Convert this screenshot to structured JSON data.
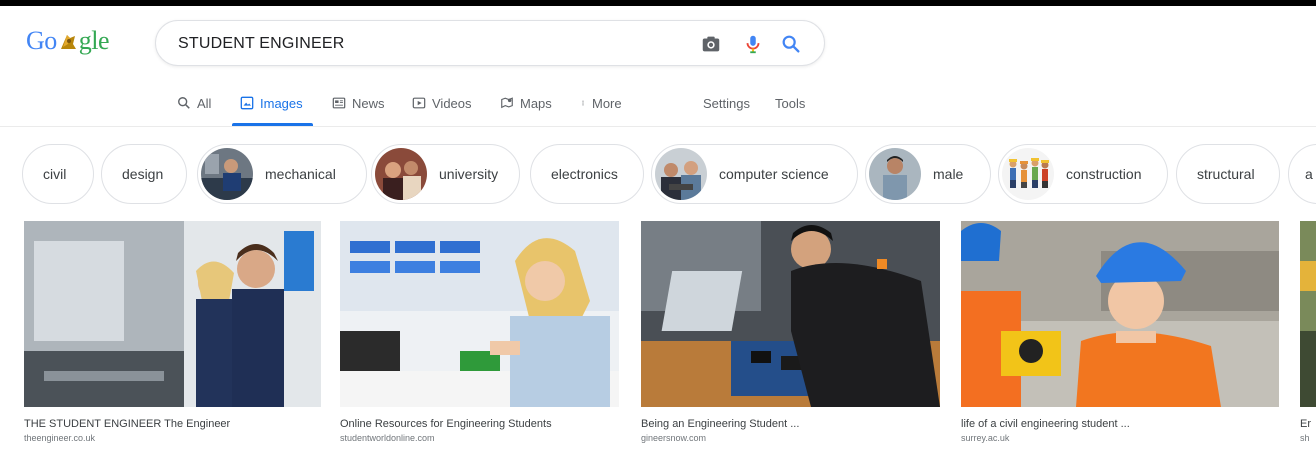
{
  "search": {
    "query": "STUDENT ENGINEER"
  },
  "logo": {
    "text_left": "Go",
    "text_right": "gle"
  },
  "tabs": [
    {
      "label": "All",
      "icon": "search-icon"
    },
    {
      "label": "Images",
      "icon": "image-icon",
      "active": true
    },
    {
      "label": "News",
      "icon": "news-icon"
    },
    {
      "label": "Videos",
      "icon": "video-icon"
    },
    {
      "label": "Maps",
      "icon": "map-icon"
    },
    {
      "label": "More",
      "icon": "more-vert-icon"
    }
  ],
  "tools": {
    "settings": "Settings",
    "tools": "Tools"
  },
  "chips": [
    {
      "label": "civil"
    },
    {
      "label": "design"
    },
    {
      "label": "mechanical",
      "thumb": true
    },
    {
      "label": "university",
      "thumb": true
    },
    {
      "label": "electronics"
    },
    {
      "label": "computer science",
      "thumb": true
    },
    {
      "label": "male",
      "thumb": true
    },
    {
      "label": "construction",
      "thumb": true
    },
    {
      "label": "structural"
    },
    {
      "label": "a"
    }
  ],
  "results": [
    {
      "title": "THE STUDENT ENGINEER The Engineer",
      "source": "theengineer.co.uk"
    },
    {
      "title": "Online Resources for Engineering Students",
      "source": "studentworldonline.com"
    },
    {
      "title": "Being an Engineering Student ...",
      "source": "gineersnow.com"
    },
    {
      "title": "life of a civil engineering student ...",
      "source": "surrey.ac.uk"
    },
    {
      "title": "Er",
      "source": "sh"
    }
  ],
  "colors": {
    "accent": "#1a73e8",
    "border": "#dfe1e5",
    "text": "#202124",
    "muted": "#70757a"
  }
}
